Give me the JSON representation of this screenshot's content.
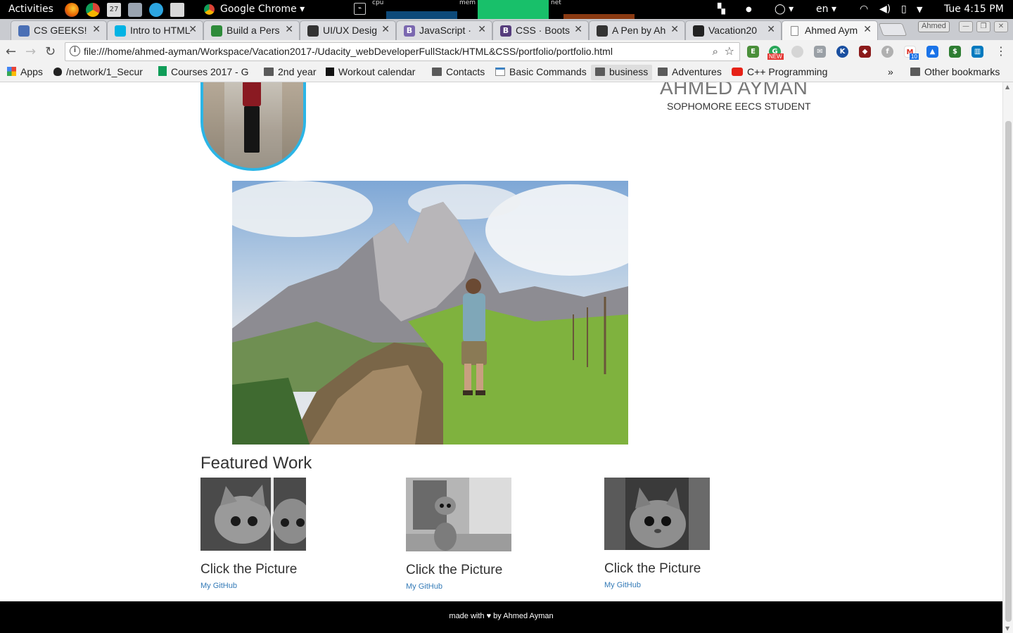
{
  "system_bar": {
    "activities": "Activities",
    "app_menu": "Google Chrome",
    "monitors": [
      "cpu",
      "mem",
      "net"
    ],
    "input_language": "en",
    "clock": "Tue  4:15 PM",
    "calendar_day": "27"
  },
  "browser": {
    "tabs": [
      {
        "title": "CS GEEKS!",
        "icon_color": "#4a6fb5",
        "active": false
      },
      {
        "title": "Intro to HTML",
        "icon_color": "#02b3e4",
        "active": false
      },
      {
        "title": "Build a Pers",
        "icon_color": "#2e8b3a",
        "active": false
      },
      {
        "title": "UI/UX Desig",
        "icon_color": "#333333",
        "active": false
      },
      {
        "title": "JavaScript ·",
        "icon_color": "#7b68b0",
        "active": false
      },
      {
        "title": "CSS · Boots",
        "icon_color": "#563d7c",
        "active": false
      },
      {
        "title": "A Pen by Ah",
        "icon_color": "#333333",
        "active": false
      },
      {
        "title": "Vacation20",
        "icon_color": "#222222",
        "active": false
      },
      {
        "title": "Ahmed Aym",
        "icon_color": "#888888",
        "active": true
      }
    ],
    "profile_name": "Ahmed",
    "url": "file:///home/ahmed-ayman/Workspace/Vacation2017-/Udacity_webDeveloperFullStack/HTML&CSS/portfolio/portfolio.html",
    "ext_badge_new": "NEW",
    "ext_badge_mail": "10",
    "bookmarks": [
      {
        "label": "Apps",
        "kind": "apps"
      },
      {
        "label": "/network/1_Secur",
        "kind": "page"
      },
      {
        "label": "Courses 2017 - G",
        "kind": "sheet"
      },
      {
        "label": "2nd year",
        "kind": "folder"
      },
      {
        "label": "Workout calendar",
        "kind": "page"
      },
      {
        "label": "Contacts",
        "kind": "folder"
      },
      {
        "label": "Basic Commands",
        "kind": "page"
      },
      {
        "label": "business",
        "kind": "folder"
      },
      {
        "label": "Adventures",
        "kind": "folder"
      },
      {
        "label": "C++ Programming",
        "kind": "youtube"
      }
    ],
    "overflow_chevron": "»",
    "other_bookmarks": "Other bookmarks"
  },
  "page": {
    "owner_name": "AHMED AYMAN",
    "owner_role": "SOPHOMORE EECS STUDENT",
    "featured_title": "Featured Work",
    "works": [
      {
        "caption": "Click the Picture",
        "link": "My GitHub"
      },
      {
        "caption": "Click the Picture",
        "link": "My GitHub"
      },
      {
        "caption": "Click the Picture",
        "link": "My GitHub"
      }
    ],
    "footer": "made with ♥ by Ahmed Ayman"
  },
  "colors": {
    "avatar_border": "#2bb5e6",
    "link": "#337ab7",
    "footer_bg": "#000000"
  }
}
